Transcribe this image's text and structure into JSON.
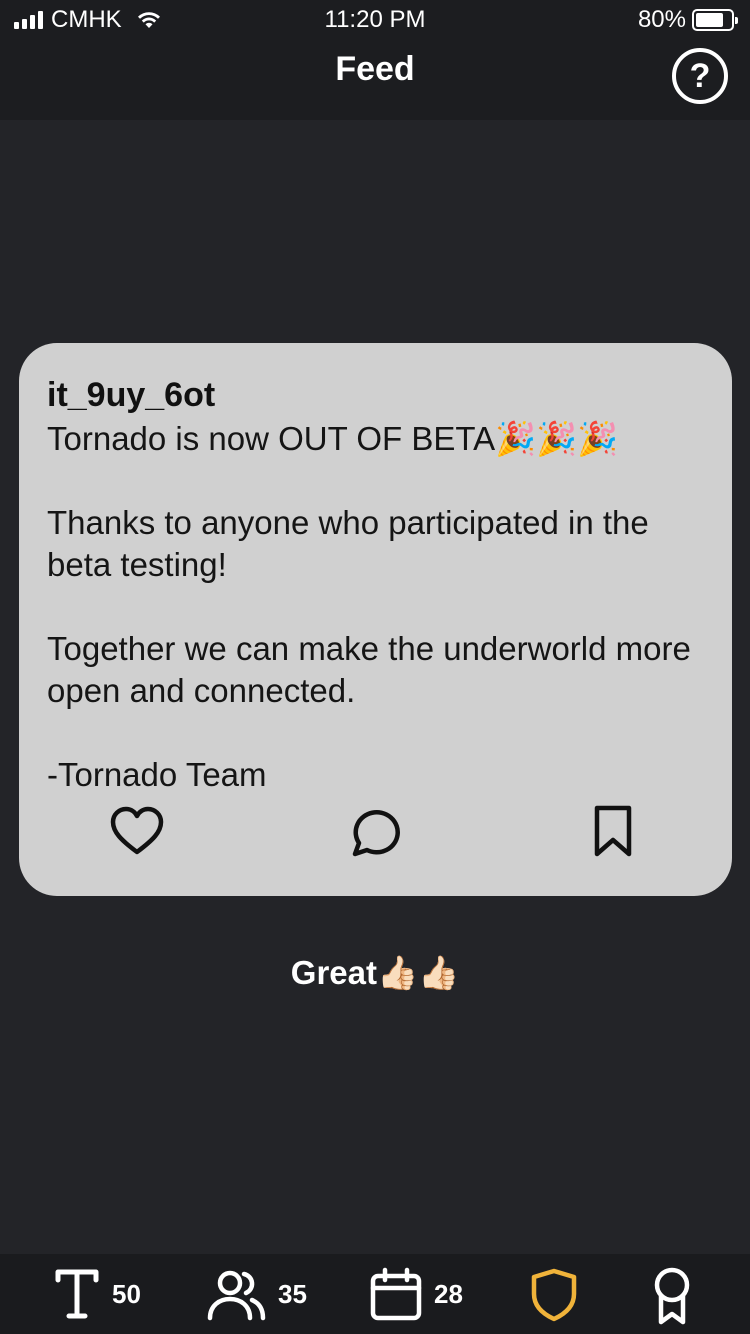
{
  "status_bar": {
    "carrier": "CMHK",
    "time": "11:20 PM",
    "battery_text": "80%",
    "battery_level": 0.8
  },
  "nav": {
    "title": "Feed",
    "help_symbol": "?"
  },
  "post": {
    "username": "it_9uy_6ot",
    "body": "Tornado is now OUT OF BETA🎉🎉🎉\n\nThanks to anyone who participated in the beta testing!\n\nTogether we can make the underworld more open and connected.\n\n-Tornado Team",
    "actions": [
      "heart-icon",
      "comment-icon",
      "bookmark-icon"
    ]
  },
  "comment": {
    "text": "Great👍🏻👍🏻"
  },
  "tab_bar": {
    "text_count": "50",
    "people_count": "35",
    "calendar_count": "28",
    "icons": [
      "text-icon",
      "people-icon",
      "calendar-icon",
      "shield-icon",
      "award-icon"
    ]
  },
  "colors": {
    "background": "#232428",
    "card": "#d0d0d0",
    "accent_shield": "#f0b33a"
  }
}
